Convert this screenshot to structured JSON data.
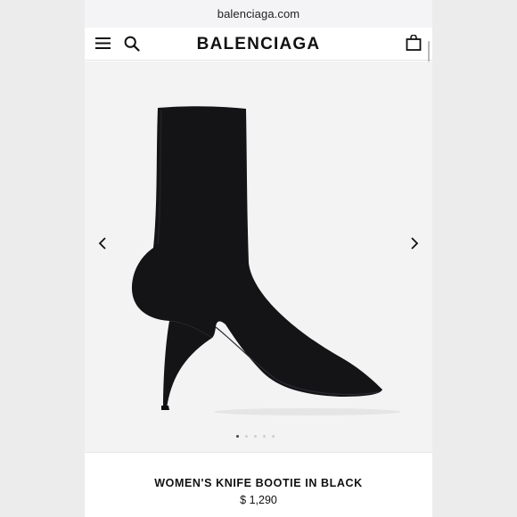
{
  "browser": {
    "url": "balenciaga.com"
  },
  "header": {
    "logo": "BALENCIAGA",
    "icons": [
      "hamburger-menu-icon",
      "search-icon",
      "shopping-bag-icon"
    ]
  },
  "gallery": {
    "image": "black-stiletto-sock-bootie",
    "slide_count": 5,
    "active_slide": 1
  },
  "product": {
    "name": "WOMEN'S KNIFE BOOTIE IN BLACK",
    "price": "$ 1,290"
  },
  "colors": {
    "background": "#ececec",
    "product_black": "#141417",
    "gallery_bg": "#f3f3f3"
  }
}
